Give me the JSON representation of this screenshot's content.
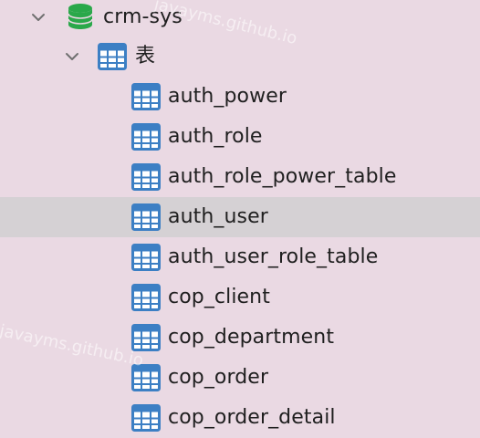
{
  "tree": {
    "database": {
      "label": "crm-sys",
      "expanded": true,
      "icon": "database-icon"
    },
    "group": {
      "label": "表",
      "expanded": true,
      "icon": "table-group-icon"
    },
    "tables": [
      {
        "label": "auth_power",
        "selected": false
      },
      {
        "label": "auth_role",
        "selected": false
      },
      {
        "label": "auth_role_power_table",
        "selected": false
      },
      {
        "label": "auth_user",
        "selected": true
      },
      {
        "label": "auth_user_role_table",
        "selected": false
      },
      {
        "label": "cop_client",
        "selected": false
      },
      {
        "label": "cop_department",
        "selected": false
      },
      {
        "label": "cop_order",
        "selected": false
      },
      {
        "label": "cop_order_detail",
        "selected": false
      }
    ]
  },
  "watermark": {
    "text_top": "javayms.github.io",
    "text_bottom": "javayms.github.io"
  },
  "colors": {
    "background": "#ead9e3",
    "selected_row": "#d5d1d4",
    "database_icon": "#2aa84a",
    "table_icon": "#3c7fc4"
  }
}
